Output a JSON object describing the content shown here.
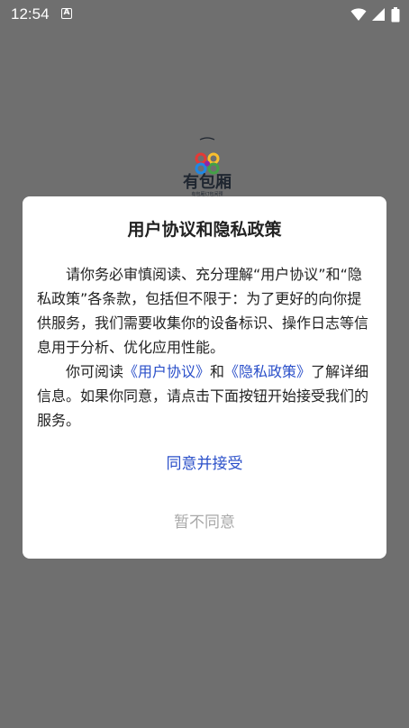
{
  "status_bar": {
    "time": "12:54",
    "notification_icon_letter": "A",
    "icons": [
      "wifi-icon",
      "cell-signal-icon",
      "battery-icon"
    ]
  },
  "background": {
    "app_name": "有包厢",
    "app_tagline": "有包厢订包间预",
    "logo_colors": [
      "#e53935",
      "#fbc02d",
      "#43a047",
      "#1e88e5",
      "#8e24aa"
    ]
  },
  "dialog": {
    "title": "用户协议和隐私政策",
    "paragraph1": "请你务必审慎阅读、充分理解“用户协议”和“隐私政策”各条款，包括但不限于：为了更好的向你提供服务，我们需要收集你的设备标识、操作日志等信息用于分析、优化应用性能。",
    "paragraph2_prefix": "你可阅读",
    "user_agreement_link": "《用户协议》",
    "paragraph2_and": "和",
    "privacy_policy_link": "《隐私政策》",
    "paragraph2_suffix": "了解详细信息。如果你同意，请点击下面按钮开始接受我们的服务。",
    "agree_button": "同意并接受",
    "disagree_button": "暂不同意"
  },
  "colors": {
    "overlay": "#6f6f6f",
    "link": "#2a4fc9",
    "disabled_text": "#a8a8a8"
  }
}
